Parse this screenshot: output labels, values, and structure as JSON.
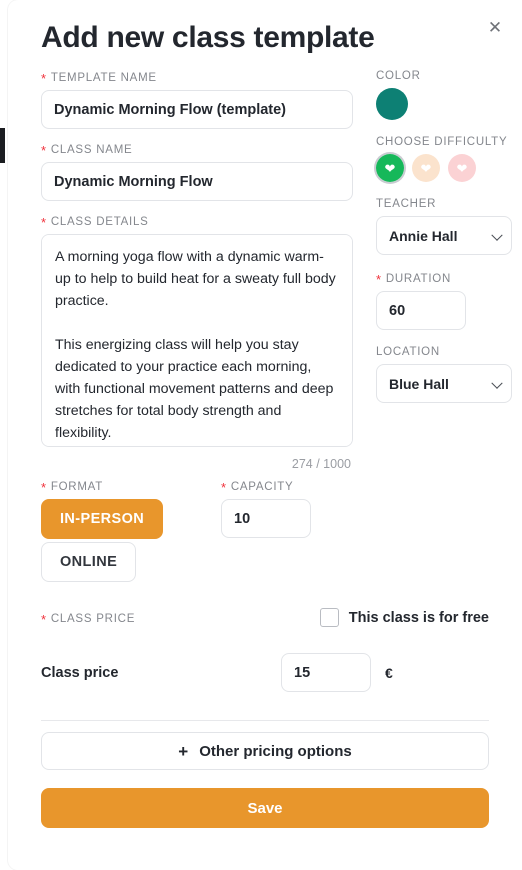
{
  "modal": {
    "title": "Add new class template",
    "close_icon": "close-icon"
  },
  "fields": {
    "template_name": {
      "label": "TEMPLATE NAME",
      "required": "*",
      "value": "Dynamic Morning Flow (template)",
      "placeholder": "Template name"
    },
    "class_name": {
      "label": "CLASS NAME",
      "required": "*",
      "value": "Dynamic Morning Flow",
      "placeholder": "Class name"
    },
    "class_details": {
      "label": "CLASS DETAILS",
      "required": "*",
      "value": "A morning yoga flow with a dynamic warm-up to help to build heat for a sweaty full body practice.\n\nThis energizing class will help you stay dedicated to your practice each morning, with functional movement patterns and deep stretches for total body strength and flexibility.",
      "placeholder": "Class details",
      "char_count": "274 / 1000"
    },
    "color": {
      "label": "COLOR",
      "selected_hex": "#0d8074"
    },
    "difficulty": {
      "label": "CHOOSE DIFFICULTY",
      "options": [
        {
          "name": "easy",
          "hex": "#16b85a",
          "selected": true
        },
        {
          "name": "medium",
          "hex": "#fbe3cd",
          "selected": false
        },
        {
          "name": "hard",
          "hex": "#fbd2d4",
          "selected": false
        }
      ]
    },
    "teacher": {
      "label": "TEACHER",
      "value": "Annie Hall",
      "chevron_icon": "chevron-down-icon"
    },
    "duration": {
      "label": "DURATION",
      "required": "*",
      "value": "60",
      "placeholder": "Duration"
    },
    "location": {
      "label": "LOCATION",
      "value": "Blue Hall",
      "chevron_icon": "chevron-down-icon"
    },
    "format": {
      "label": "FORMAT",
      "required": "*",
      "options": [
        {
          "label": "IN-PERSON",
          "selected": true
        },
        {
          "label": "ONLINE",
          "selected": false
        }
      ]
    },
    "capacity": {
      "label": "CAPACITY",
      "required": "*",
      "value": "10",
      "placeholder": "Capacity"
    },
    "class_price": {
      "label": "CLASS PRICE",
      "required": "*",
      "free_checkbox_label": "This class is for free",
      "free_checked": false,
      "row_name": "Class price",
      "value": "15",
      "placeholder": "Price",
      "currency": "€"
    }
  },
  "actions": {
    "other_pricing_label": "Other pricing options",
    "other_pricing_icon": "plus-icon",
    "save_label": "Save"
  },
  "colors": {
    "accent_orange": "#e8962c",
    "teal": "#0d8074",
    "required_red": "#f0323c"
  }
}
